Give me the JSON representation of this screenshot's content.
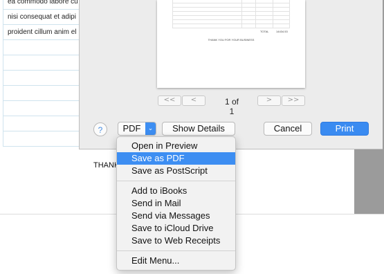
{
  "background_document": {
    "rows": [
      "ea commodo labore cu",
      "nisi consequat et adipi",
      "proident cillum anim el"
    ],
    "thank_text": "THANK"
  },
  "print_dialog": {
    "preview": {
      "total_label": "TOTAL",
      "total_value": "14434.53",
      "thanks_text": "THANK YOU FOR YOUR BUSINESS"
    },
    "pager": {
      "first_label": "<<",
      "prev_label": "<",
      "page_text": "1 of 1",
      "next_label": ">",
      "last_label": ">>"
    },
    "help_label": "?",
    "pdf_label": "PDF",
    "pdf_arrow": "⌄",
    "show_details_label": "Show Details",
    "cancel_label": "Cancel",
    "print_label": "Print"
  },
  "pdf_menu": {
    "items": [
      "Open in Preview",
      "Save as PDF",
      "Save as PostScript",
      "Add to iBooks",
      "Send in Mail",
      "Send via Messages",
      "Save to iCloud Drive",
      "Save to Web Receipts",
      "Edit Menu..."
    ],
    "active_item": "Save as PDF"
  },
  "colors": {
    "accent": "#3d8ef2",
    "dialog_bg": "#ececec",
    "menu_bg": "#f2f2f2"
  }
}
